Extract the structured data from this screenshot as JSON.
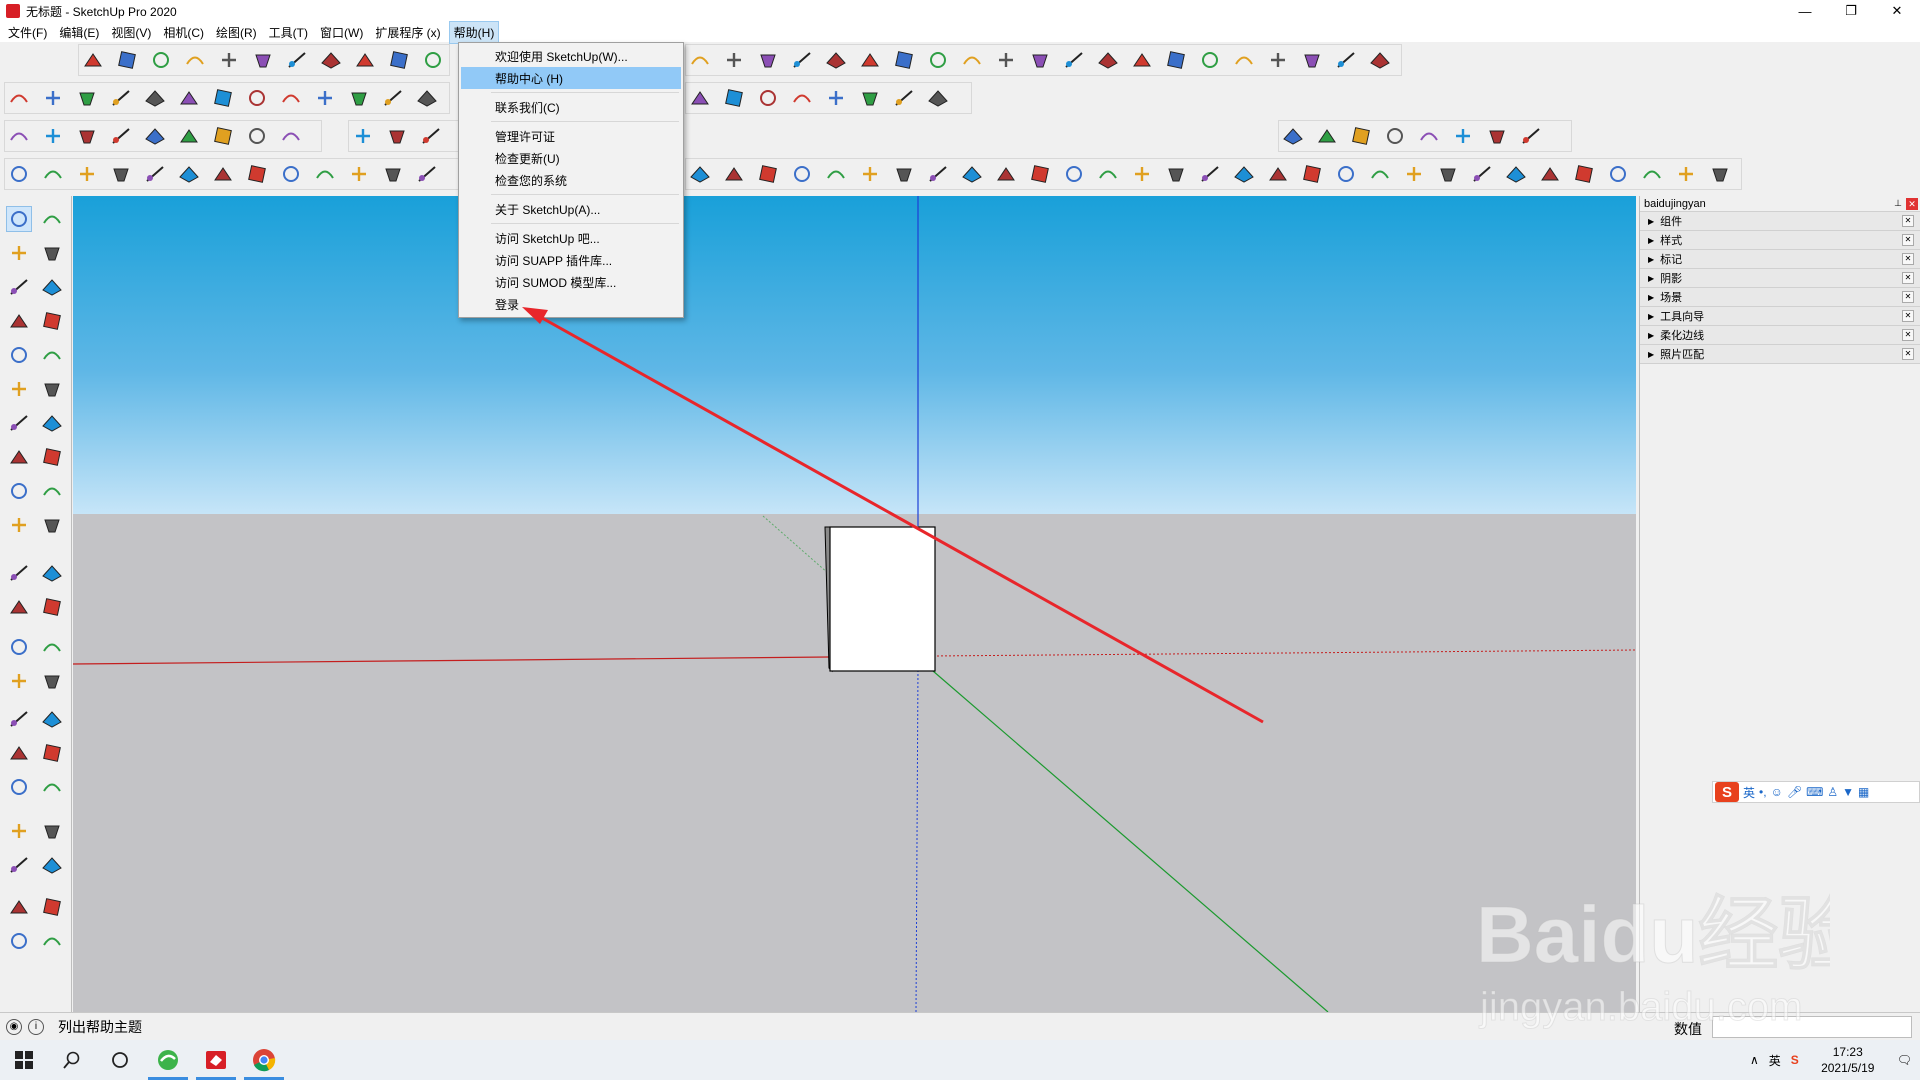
{
  "window": {
    "title": "无标题 - SketchUp Pro 2020",
    "controls": [
      "—",
      "❐",
      "✕"
    ]
  },
  "menubar": [
    {
      "label": "文件(F)"
    },
    {
      "label": "编辑(E)"
    },
    {
      "label": "视图(V)"
    },
    {
      "label": "相机(C)"
    },
    {
      "label": "绘图(R)"
    },
    {
      "label": "工具(T)"
    },
    {
      "label": "窗口(W)"
    },
    {
      "label": "扩展程序 (x)"
    },
    {
      "label": "帮助(H)",
      "active": true
    }
  ],
  "help_menu": {
    "items": [
      {
        "label": "欢迎使用 SketchUp(W)...",
        "separator_after": false
      },
      {
        "label": "帮助中心 (H)",
        "highlighted": true,
        "separator_after": true
      },
      {
        "label": "联系我们(C)",
        "separator_after": true
      },
      {
        "label": "管理许可证",
        "separator_after": false
      },
      {
        "label": "检查更新(U)",
        "separator_after": false
      },
      {
        "label": "检查您的系统",
        "separator_after": true
      },
      {
        "label": "关于 SketchUp(A)...",
        "separator_after": true
      },
      {
        "label": "访问 SketchUp 吧...",
        "separator_after": false
      },
      {
        "label": "访问 SUAPP 插件库...",
        "separator_after": false
      },
      {
        "label": "访问 SUMOD 模型库...",
        "separator_after": false
      },
      {
        "label": "登录",
        "separator_after": false
      }
    ]
  },
  "tray": {
    "title": "baidujingyan",
    "panels": [
      {
        "label": "组件"
      },
      {
        "label": "样式"
      },
      {
        "label": "标记"
      },
      {
        "label": "阴影"
      },
      {
        "label": "场景"
      },
      {
        "label": "工具向导"
      },
      {
        "label": "柔化边线"
      },
      {
        "label": "照片匹配"
      }
    ]
  },
  "ime": {
    "logo": "S",
    "mode": "英"
  },
  "statusbar": {
    "hint": "列出帮助主题",
    "vcb_label": "数值",
    "vcb_value": ""
  },
  "taskbar": {
    "time": "17:23",
    "date": "2021/5/19",
    "tray_ime": "英"
  },
  "colors": {
    "accent_red": "#e8262b",
    "menu_highlight": "#91c9f7",
    "axis_red": "#c41e1e",
    "axis_green": "#1c9a2f",
    "axis_blue": "#1d3fd6"
  },
  "watermark": {
    "brand": "Baidu经验",
    "url": "jingyan.baidu.com"
  }
}
